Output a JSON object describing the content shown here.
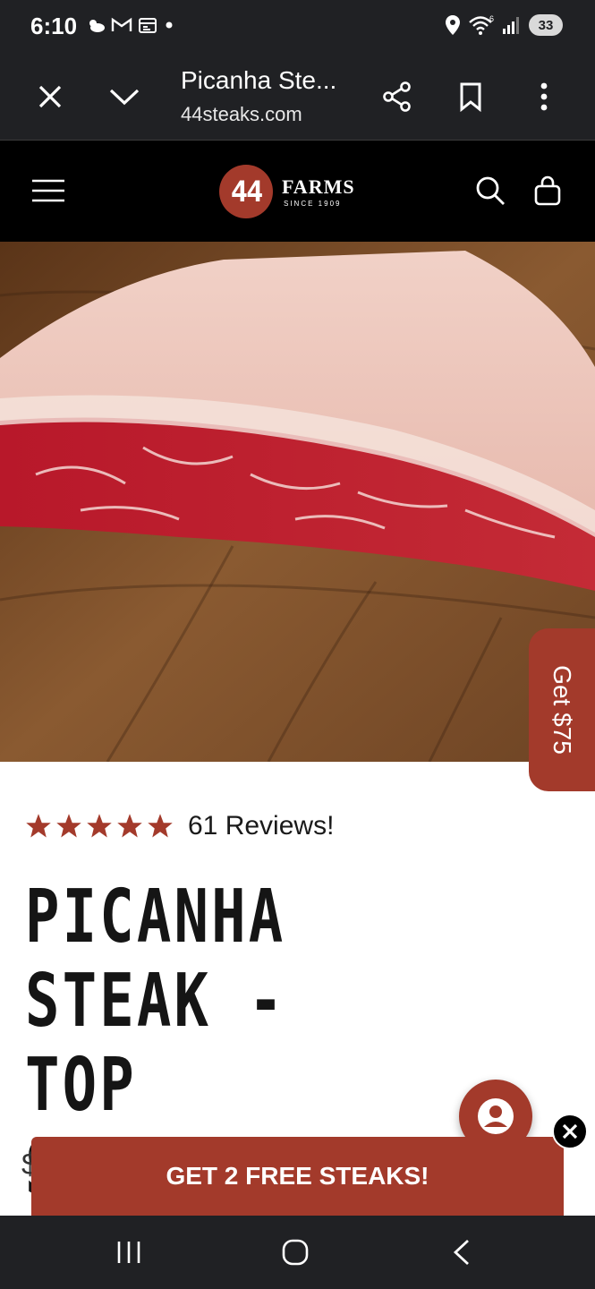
{
  "status_bar": {
    "time": "6:10",
    "battery": "33",
    "signal_label": "6"
  },
  "browser": {
    "title": "Picanha Ste...",
    "url": "44steaks.com"
  },
  "site": {
    "logo_number": "44",
    "logo_name": "FARMS",
    "logo_tagline": "SINCE 1909"
  },
  "side_tab": {
    "label": "Get $75"
  },
  "product": {
    "rating": 5,
    "reviews_label": "61 Reviews!",
    "title": "PICANHA STEAK - TOP SIRLOIN CAP STEAK",
    "price_peek": "$"
  },
  "promo": {
    "label": "GET 2 FREE STEAKS!"
  },
  "colors": {
    "brand_red": "#a33a2b",
    "dark_bar": "#202124",
    "header_black": "#000000"
  },
  "icons": {
    "status": [
      "weather-icon",
      "gmail-icon",
      "calendar-icon",
      "dot-icon",
      "location-icon",
      "wifi-icon",
      "signal-icon"
    ],
    "browser": [
      "close-icon",
      "chevron-down-icon",
      "share-icon",
      "bookmark-icon",
      "more-vert-icon"
    ],
    "header": [
      "menu-icon",
      "search-icon",
      "cart-icon"
    ],
    "nav": [
      "recents-icon",
      "home-icon",
      "back-icon"
    ]
  }
}
